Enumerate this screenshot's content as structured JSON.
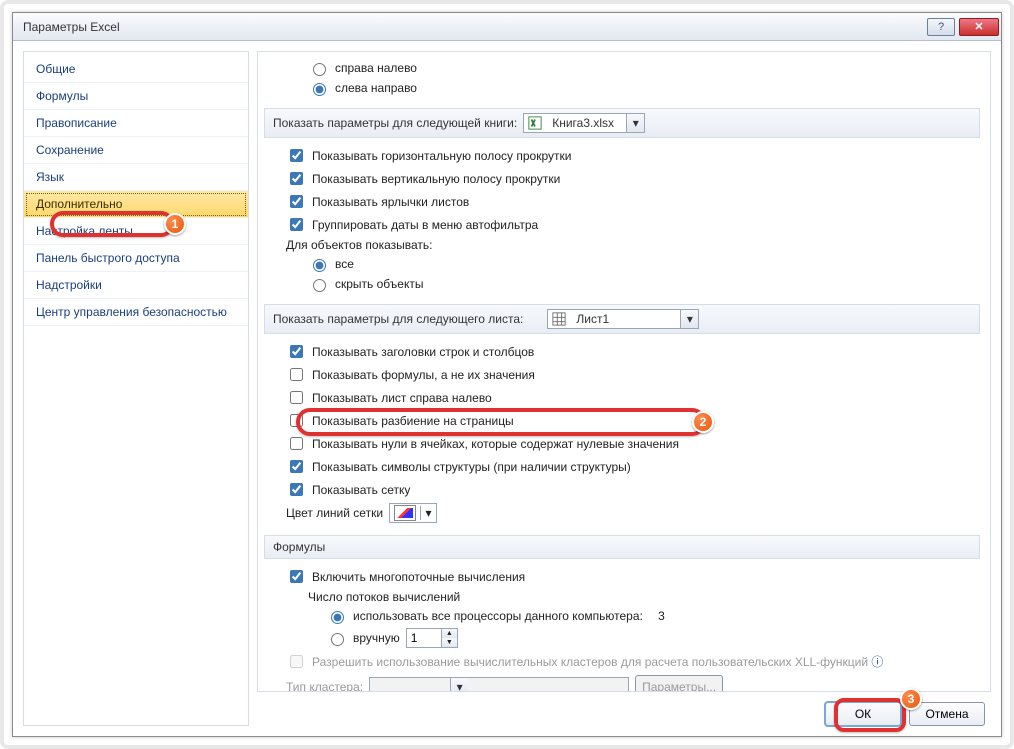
{
  "window": {
    "title": "Параметры Excel"
  },
  "sidebar": {
    "items": [
      {
        "label": "Общие"
      },
      {
        "label": "Формулы"
      },
      {
        "label": "Правописание"
      },
      {
        "label": "Сохранение"
      },
      {
        "label": "Язык"
      },
      {
        "label": "Дополнительно"
      },
      {
        "label": "Настройка ленты"
      },
      {
        "label": "Панель быстрого доступа"
      },
      {
        "label": "Надстройки"
      },
      {
        "label": "Центр управления безопасностью"
      }
    ],
    "selected_index": 5
  },
  "direction": {
    "rtl": "справа налево",
    "ltr": "слева направо",
    "selected": "ltr"
  },
  "book_section": {
    "header": "Показать параметры для следующей книги:",
    "combo": "Книга3.xlsx",
    "items": [
      {
        "checked": true,
        "label": "Показывать горизонтальную полосу прокрутки"
      },
      {
        "checked": true,
        "label": "Показывать вертикальную полосу прокрутки"
      },
      {
        "checked": true,
        "label": "Показывать ярлычки листов"
      },
      {
        "checked": true,
        "label": "Группировать даты в меню автофильтра"
      }
    ],
    "objects_label": "Для объектов показывать:",
    "objects": {
      "all": "все",
      "hide": "скрыть объекты",
      "selected": "all"
    }
  },
  "sheet_section": {
    "header": "Показать параметры для следующего листа:",
    "combo": "Лист1",
    "items": [
      {
        "checked": true,
        "label": "Показывать заголовки строк и столбцов"
      },
      {
        "checked": false,
        "label": "Показывать формулы, а не их значения"
      },
      {
        "checked": false,
        "label": "Показывать лист справа налево"
      },
      {
        "checked": false,
        "label": "Показывать разбиение на страницы"
      },
      {
        "checked": false,
        "label": "Показывать нули в ячейках, которые содержат нулевые значения"
      },
      {
        "checked": true,
        "label": "Показывать символы структуры (при наличии структуры)"
      },
      {
        "checked": true,
        "label": "Показывать сетку"
      }
    ],
    "grid_color_label": "Цвет линий сетки"
  },
  "formulas_section": {
    "header": "Формулы",
    "multithread_label": "Включить многопоточные вычисления",
    "multithread_checked": true,
    "threads_label": "Число потоков вычислений",
    "use_all": "использовать все процессоры данного компьютера:",
    "cpu_count": "3",
    "manual_label": "вручную",
    "manual_value": "1",
    "selected": "all",
    "cluster_allow": "Разрешить использование вычислительных кластеров для расчета пользовательских XLL-функций",
    "cluster_type_label": "Тип кластера:",
    "cluster_params": "Параметры..."
  },
  "footer": {
    "ok": "ОК",
    "cancel": "Отмена"
  },
  "badges": {
    "b1": "1",
    "b2": "2",
    "b3": "3"
  }
}
